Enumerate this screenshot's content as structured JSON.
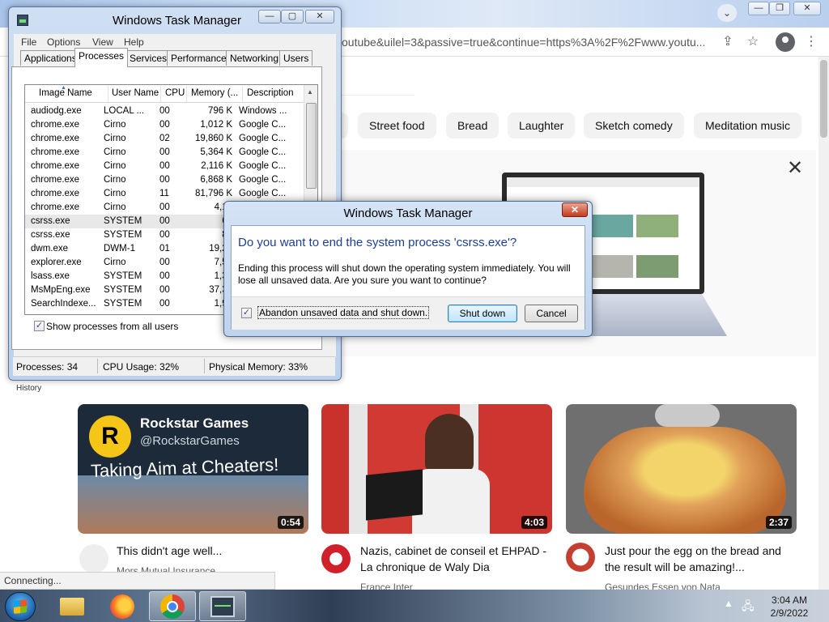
{
  "browser": {
    "url_fragment": "outube&uilel=3&passive=true&continue=https%3A%2F%2Fwww.youtu...",
    "chips": [
      "Street food",
      "Bread",
      "Laughter",
      "Sketch comedy",
      "Meditation music"
    ],
    "sidebar_history_label": "History",
    "status_bubble": "Connecting...",
    "promo_close_glyph": "✕",
    "videos": [
      {
        "title": "This didn't age well...",
        "channel": "Mors Mutual Insurance",
        "duration": "0:54",
        "thumb_text_brand": "Rockstar Games",
        "thumb_text_handle": "@RockstarGames",
        "thumb_text_headline": "Taking Aim at Cheaters!"
      },
      {
        "title": "Nazis, cabinet de conseil et EHPAD - La chronique de Waly Dia",
        "channel": "France Inter",
        "duration": "4:03"
      },
      {
        "title": "Just pour the egg on the bread and the result will be amazing!...",
        "channel": "Gesundes Essen von Nata",
        "duration": "2:37"
      }
    ]
  },
  "task_manager": {
    "title": "Windows Task Manager",
    "menu": [
      "File",
      "Options",
      "View",
      "Help"
    ],
    "tabs": [
      "Applications",
      "Processes",
      "Services",
      "Performance",
      "Networking",
      "Users"
    ],
    "active_tab": "Processes",
    "columns": [
      "Image Name",
      "User Name",
      "CPU",
      "Memory (...",
      "Description"
    ],
    "processes": [
      {
        "name": "audiodg.exe",
        "user": "LOCAL ...",
        "cpu": "00",
        "mem": "796 K",
        "desc": "Windows ..."
      },
      {
        "name": "chrome.exe",
        "user": "Cirno",
        "cpu": "00",
        "mem": "1,012 K",
        "desc": "Google C..."
      },
      {
        "name": "chrome.exe",
        "user": "Cirno",
        "cpu": "02",
        "mem": "19,860 K",
        "desc": "Google C..."
      },
      {
        "name": "chrome.exe",
        "user": "Cirno",
        "cpu": "00",
        "mem": "5,364 K",
        "desc": "Google C..."
      },
      {
        "name": "chrome.exe",
        "user": "Cirno",
        "cpu": "00",
        "mem": "2,116 K",
        "desc": "Google C..."
      },
      {
        "name": "chrome.exe",
        "user": "Cirno",
        "cpu": "00",
        "mem": "6,868 K",
        "desc": "Google C..."
      },
      {
        "name": "chrome.exe",
        "user": "Cirno",
        "cpu": "11",
        "mem": "81,796 K",
        "desc": "Google C..."
      },
      {
        "name": "chrome.exe",
        "user": "Cirno",
        "cpu": "00",
        "mem": "4,13",
        "desc": ""
      },
      {
        "name": "csrss.exe",
        "user": "SYSTEM",
        "cpu": "00",
        "mem": "68",
        "desc": ""
      },
      {
        "name": "csrss.exe",
        "user": "SYSTEM",
        "cpu": "00",
        "mem": "88",
        "desc": ""
      },
      {
        "name": "dwm.exe",
        "user": "DWM-1",
        "cpu": "01",
        "mem": "19,24",
        "desc": ""
      },
      {
        "name": "explorer.exe",
        "user": "Cirno",
        "cpu": "00",
        "mem": "7,53",
        "desc": ""
      },
      {
        "name": "lsass.exe",
        "user": "SYSTEM",
        "cpu": "00",
        "mem": "1,35",
        "desc": ""
      },
      {
        "name": "MsMpEng.exe",
        "user": "SYSTEM",
        "cpu": "00",
        "mem": "37,32",
        "desc": ""
      },
      {
        "name": "SearchIndexe...",
        "user": "SYSTEM",
        "cpu": "00",
        "mem": "1,93",
        "desc": ""
      }
    ],
    "selected_row": 8,
    "show_all_users_label": "Show processes from all users",
    "show_all_users_checked": true,
    "status": {
      "processes": "Processes: 34",
      "cpu": "CPU Usage: 32%",
      "memory": "Physical Memory: 33%"
    }
  },
  "dialog": {
    "title": "Windows Task Manager",
    "heading": "Do you want to end the system process 'csrss.exe'?",
    "body": "Ending this process will shut down the operating system immediately.  You will lose all unsaved data.  Are you sure you want to continue?",
    "checkbox_label": "Abandon unsaved data and shut down.",
    "checkbox_checked": true,
    "shutdown_label": "Shut down",
    "cancel_label": "Cancel",
    "close_glyph": "✕"
  },
  "taskbar": {
    "time": "3:04 AM",
    "date": "2/9/2022"
  },
  "colors": {
    "dialog_heading": "#1c3f94",
    "taskbar": "#3b4f68",
    "close_button": "#c43b1e"
  }
}
